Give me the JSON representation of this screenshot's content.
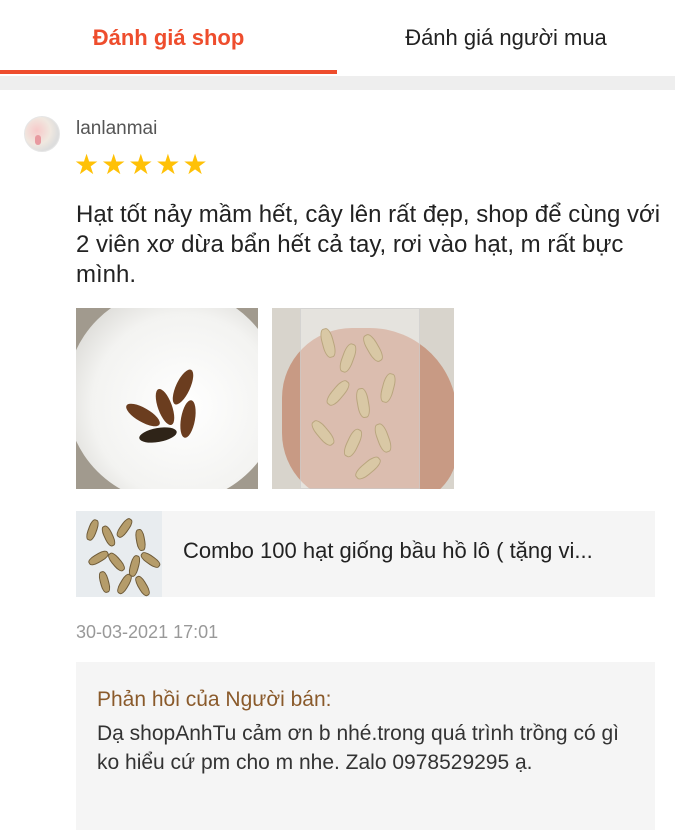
{
  "tabs": {
    "shop_review": "Đánh giá shop",
    "buyer_review": "Đánh giá người mua"
  },
  "review": {
    "username": "lanlanmai",
    "rating": 5,
    "text": "Hạt tốt nảy mầm hết, cây lên rất đẹp, shop để cùng với 2 viên xơ dừa bẩn hết cả tay, rơi vào hạt, m rất bực mình.",
    "timestamp": "30-03-2021 17:01"
  },
  "product": {
    "title": "Combo 100 hạt giống bầu hồ lô ( tặng vi..."
  },
  "seller_reply": {
    "title": "Phản hồi của Người bán:",
    "text": "Dạ shopAnhTu cảm ơn b nhé.trong quá trình trồng có gì ko hiểu cứ pm cho m nhe. Zalo 0978529295 ạ."
  },
  "colors": {
    "accent": "#ee4d2d",
    "star": "#ffc107",
    "reply_title": "#8a5a2b"
  }
}
